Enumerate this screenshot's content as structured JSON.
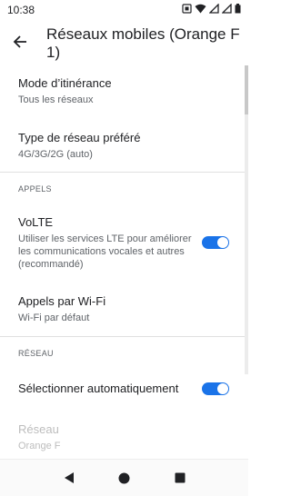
{
  "status_bar": {
    "time": "10:38"
  },
  "app_bar": {
    "title": "Réseaux mobiles (Orange F\n1)"
  },
  "settings": {
    "roaming": {
      "label": "Mode d’itinérance",
      "summary": "Tous les réseaux"
    },
    "network_type": {
      "label": "Type de réseau préféré",
      "summary": "4G/3G/2G (auto)"
    },
    "calls_header": "APPELS",
    "volte": {
      "label": "VoLTE",
      "summary": "Utiliser les services LTE pour améliorer les communications vocales et autres (recommandé)",
      "enabled": true
    },
    "wifi_calls": {
      "label": "Appels par Wi-Fi",
      "summary": "Wi-Fi par défaut"
    },
    "network_header": "RÉSEAU",
    "auto_select": {
      "label": "Sélectionner automatiquement",
      "enabled": true
    },
    "network": {
      "label": "Réseau",
      "summary": "Orange F"
    }
  },
  "colors": {
    "accent": "#1a73e8",
    "text_primary": "#202124",
    "text_secondary": "#5f6368",
    "disabled": "#bdbdbd"
  },
  "icons": {
    "status": [
      "sim-icon",
      "wifi-icon",
      "signal-icon",
      "signal-icon",
      "battery-icon"
    ],
    "nav": [
      "back-triangle-icon",
      "home-circle-icon",
      "recents-square-icon"
    ]
  }
}
